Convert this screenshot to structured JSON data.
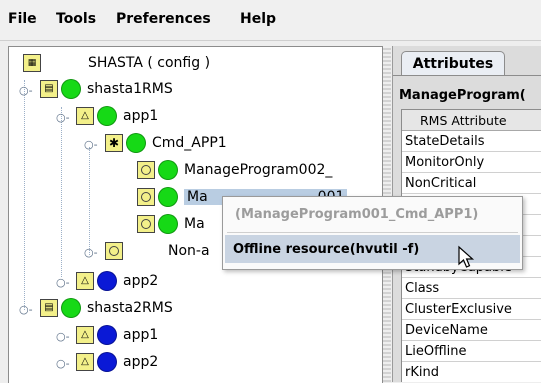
{
  "menu": {
    "items": [
      "File",
      "Tools",
      "Preferences",
      "Help"
    ]
  },
  "tree": {
    "root": "SHASTA ( config )",
    "shasta1": "shasta1RMS",
    "app1": "app1",
    "cmd": "Cmd_APP1",
    "mp002": "ManageProgram002_",
    "mp001_visible": "Ma",
    "mp001_visible_tail": "001",
    "mp3_visible": "Ma",
    "nonauto": "Non-a",
    "app2": "app2",
    "shasta2": "shasta2RMS",
    "s2_app1": "app1",
    "s2_app2": "app2"
  },
  "colors": {
    "green": "#16d916",
    "blue": "#0a19d6",
    "selection": "#b9cde2",
    "menu_highlight": "#c9d4e2"
  },
  "context_menu": {
    "title": "(ManageProgram001_Cmd_APP1)",
    "item": "Offline resource(hvutil -f)"
  },
  "right_panel": {
    "tab": "Attributes",
    "heading": "ManageProgram(",
    "column_header": "RMS Attribute",
    "rows": [
      "StateDetails",
      "MonitorOnly",
      "NonCritical",
      "",
      "",
      "",
      "StandbyCapable",
      "Class",
      "ClusterExclusive",
      "DeviceName",
      "LieOffline",
      "rKind"
    ]
  }
}
